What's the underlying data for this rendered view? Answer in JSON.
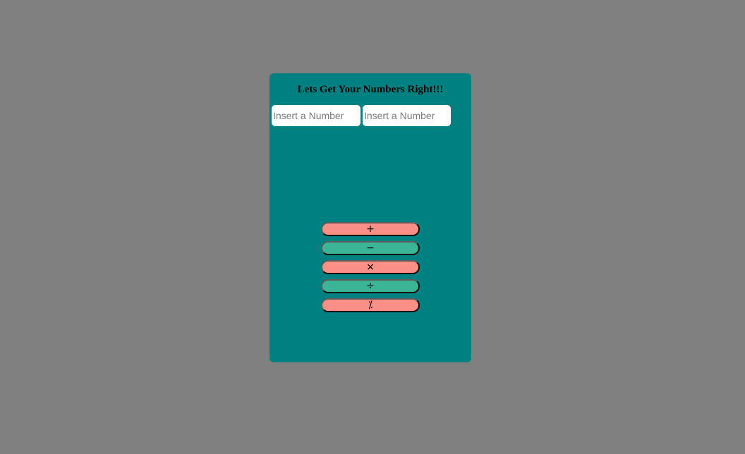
{
  "heading": "Lets Get Your Numbers Right!!!",
  "inputs": {
    "first_placeholder": "Insert a Number",
    "second_placeholder": "Insert a Number"
  },
  "operations": {
    "add_label": "+",
    "subtract_label": "−",
    "multiply_label": "×",
    "divide_label": "÷",
    "percent_label": "⁒"
  },
  "colors": {
    "page_background": "#808080",
    "card_background": "#008080",
    "button_pink": "#fa8f88",
    "button_green": "#3cb496"
  }
}
